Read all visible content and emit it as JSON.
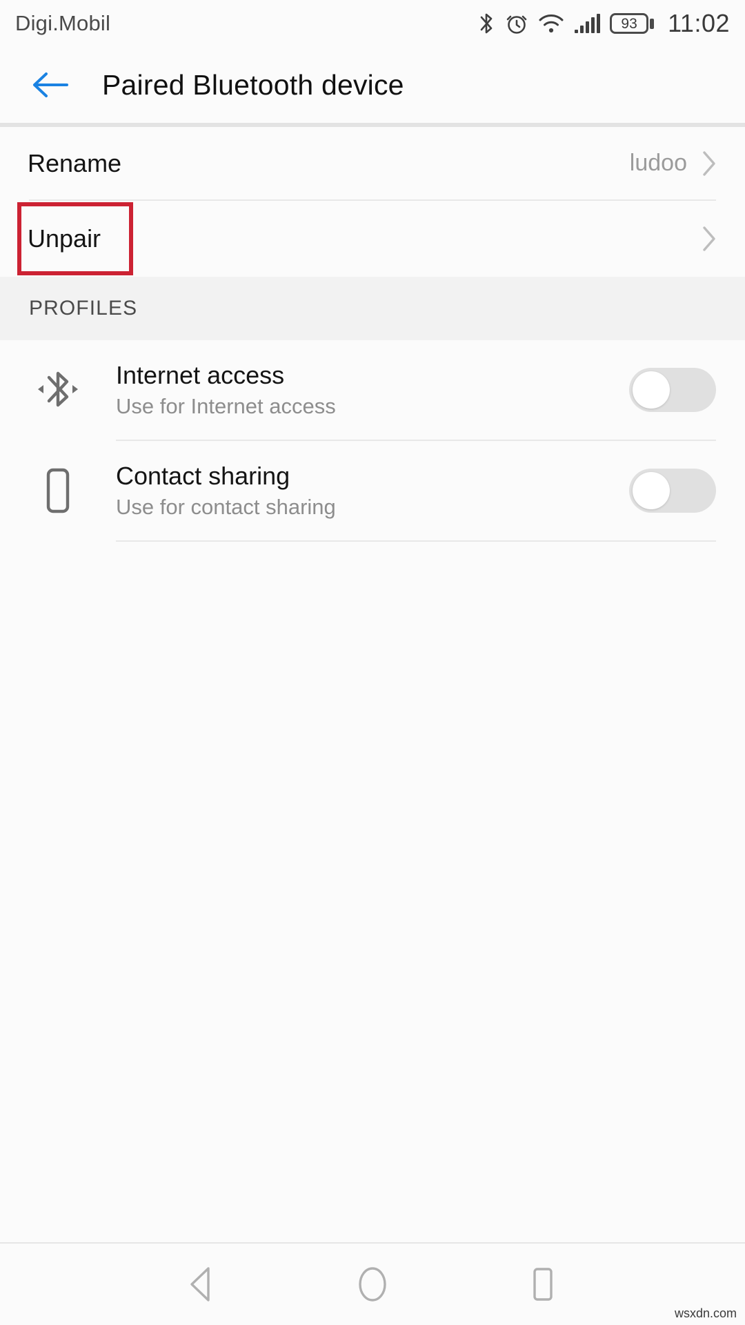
{
  "status_bar": {
    "carrier": "Digi.Mobil",
    "battery_percent": "93",
    "time": "11:02",
    "icons": [
      "bluetooth-icon",
      "alarm-icon",
      "wifi-icon",
      "signal-icon",
      "battery-icon"
    ]
  },
  "title_bar": {
    "back_icon": "back-arrow-icon",
    "title": "Paired Bluetooth device",
    "accent_color": "#1a82e2"
  },
  "settings": {
    "rename": {
      "label": "Rename",
      "value": "ludoo",
      "chevron": "chevron-right-icon"
    },
    "unpair": {
      "label": "Unpair",
      "chevron": "chevron-right-icon",
      "highlighted": true,
      "highlight_color": "#cc2233"
    }
  },
  "profiles_section": {
    "header": "PROFILES",
    "items": [
      {
        "icon": "bluetooth-tethering-icon",
        "title": "Internet access",
        "subtitle": "Use for Internet access",
        "toggle_state": "off"
      },
      {
        "icon": "phone-icon",
        "title": "Contact sharing",
        "subtitle": "Use for contact sharing",
        "toggle_state": "off"
      }
    ]
  },
  "nav_bar": {
    "back": "nav-back-icon",
    "home": "nav-home-icon",
    "recents": "nav-recents-icon"
  },
  "watermark": "wsxdn.com"
}
